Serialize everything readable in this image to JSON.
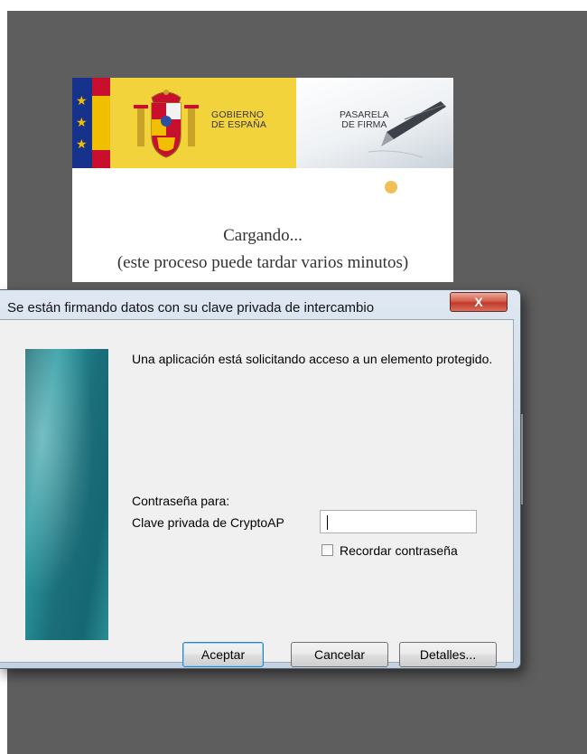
{
  "panel": {
    "gov_line1": "GOBIERNO",
    "gov_line2": "DE ESPAÑA",
    "pasarela_line1": "PASARELA",
    "pasarela_line2": "DE FIRMA",
    "loading_title": "Cargando...",
    "loading_subtitle": "(este proceso puede tardar varios minutos)"
  },
  "dialog": {
    "title": "Se están firmando datos con su clave privada de intercambio",
    "close_label": "X",
    "message": "Una aplicación está solicitando acceso a un elemento protegido.",
    "password_for_label": "Contraseña para:",
    "key_label": "Clave privada de CryptoAP",
    "password_value": "",
    "remember_label": "Recordar contraseña",
    "remember_checked": false,
    "buttons": {
      "accept": "Aceptar",
      "cancel": "Cancelar",
      "details": "Detalles..."
    }
  },
  "colors": {
    "backdrop": "#5e5e5e",
    "gov_yellow": "#f3d33b",
    "eu_blue": "#17328a",
    "spain_red": "#c8102e",
    "loading_dot": "#f0c058",
    "side_panel_teal": "#1b6f7a"
  }
}
